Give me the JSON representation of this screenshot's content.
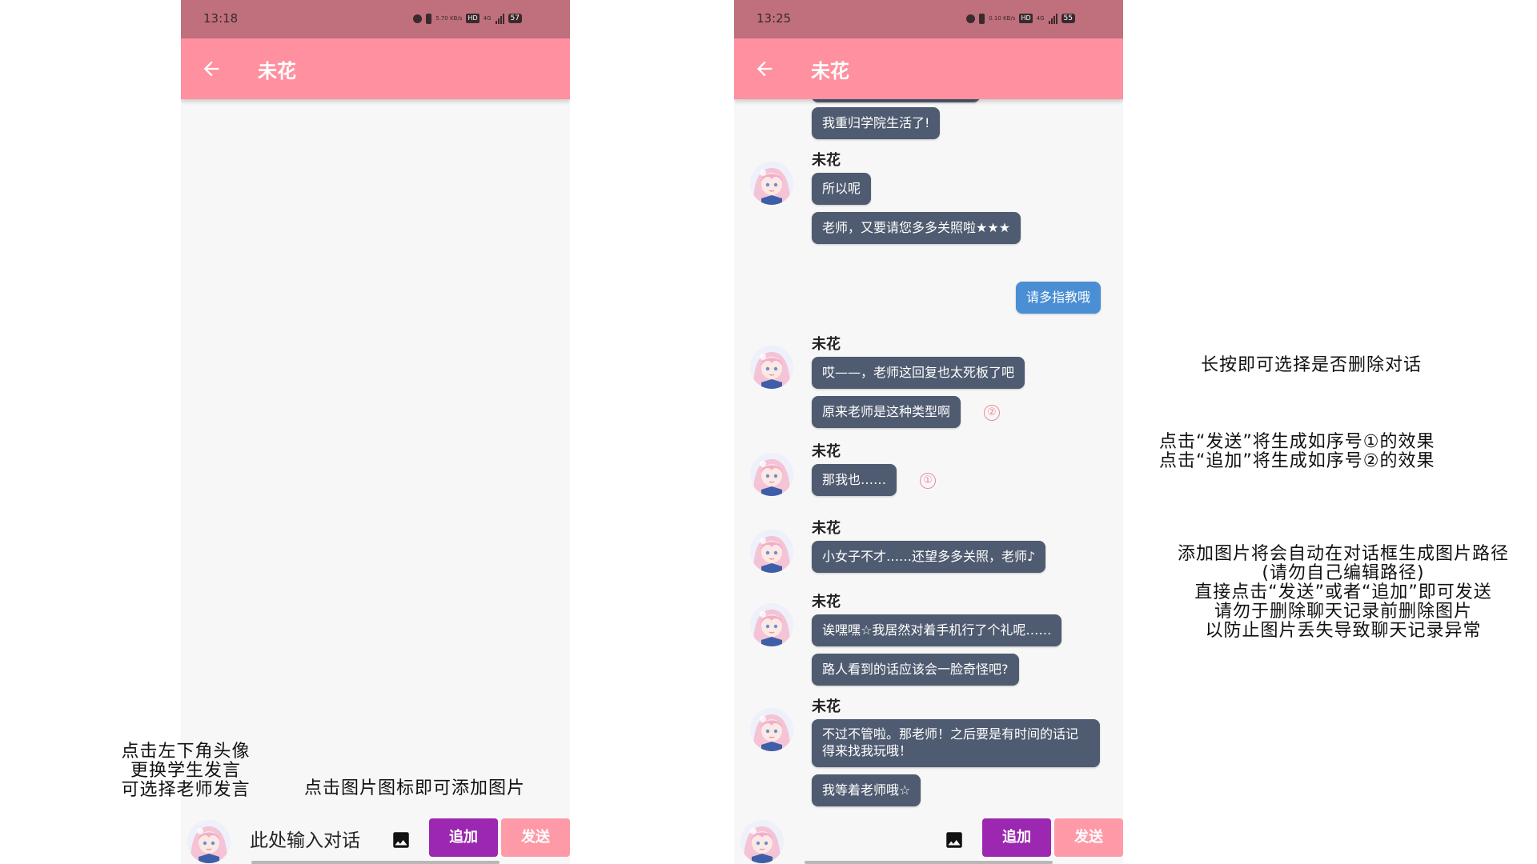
{
  "colors": {
    "status_bar": "#c0707c",
    "app_bar": "#ff909f",
    "bot_bubble": "#4f5b70",
    "user_bubble": "#4a8ed4",
    "add_button": "#9c27b0",
    "send_button": "#ff909f",
    "marker": "#f08a9a"
  },
  "icons": {
    "back": "arrow-left-icon",
    "image": "image-icon",
    "avatar": "avatar-pink-hair-girl"
  },
  "left_phone": {
    "status": {
      "time": "13:18",
      "speed": "5.70 KB/s",
      "network": "4G",
      "battery": "57"
    },
    "header": {
      "title": "未花"
    },
    "bottom": {
      "input_placeholder": "此处输入对话",
      "add_label": "追加",
      "send_label": "发送"
    }
  },
  "right_phone": {
    "status": {
      "time": "13:25",
      "speed": "0.10 KB/s",
      "network": "4G",
      "battery": "55"
    },
    "header": {
      "title": "未花"
    },
    "chat": {
      "top_bubble": "我重归学院生活了!",
      "groups": [
        {
          "name": "未花",
          "messages": [
            "所以呢",
            "老师，又要请您多多关照啦★★★"
          ]
        },
        {
          "user_message": "请多指教哦"
        },
        {
          "name": "未花",
          "messages": [
            "哎——，老师这回复也太死板了吧",
            "原来老师是这种类型啊"
          ],
          "marker": "②"
        },
        {
          "name": "未花",
          "messages": [
            "那我也……"
          ],
          "marker": "①"
        },
        {
          "name": "未花",
          "messages": [
            "小女子不才……还望多多关照，老师♪"
          ]
        },
        {
          "name": "未花",
          "messages": [
            "诶嘿嘿☆我居然对着手机行了个礼呢……",
            "路人看到的话应该会一脸奇怪吧?"
          ]
        },
        {
          "name": "未花",
          "messages": [
            "不过不管啦。那老师！之后要是有时间的话记得来找我玩哦！",
            "我等着老师哦☆"
          ]
        }
      ]
    },
    "bottom": {
      "add_label": "追加",
      "send_label": "发送"
    }
  },
  "annotations": {
    "avatar_hint": [
      "点击左下角头像",
      "更换学生发言",
      "可选择老师发言"
    ],
    "image_hint": "点击图片图标即可添加图片",
    "delete_hint": "长按即可选择是否删除对话",
    "send_hint": [
      "点击“发送”将生成如序号①的效果",
      "点击“追加”将生成如序号②的效果"
    ],
    "image_path_hint": [
      "添加图片将会自动在对话框生成图片路径",
      "(请勿自己编辑路径)",
      "直接点击“发送”或者“追加”即可发送",
      "请勿于删除聊天记录前删除图片",
      "以防止图片丢失导致聊天记录异常"
    ]
  }
}
